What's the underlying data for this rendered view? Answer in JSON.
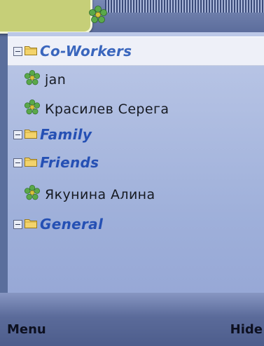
{
  "contact_list": {
    "items": [
      {
        "type": "group",
        "label": "Co-Workers",
        "selected": true
      },
      {
        "type": "contact",
        "label": "jan"
      },
      {
        "type": "contact",
        "label": "Красилев Серега"
      },
      {
        "type": "group",
        "label": "Family"
      },
      {
        "type": "group",
        "label": "Friends"
      },
      {
        "type": "contact",
        "label": "Якунина Алина"
      },
      {
        "type": "group",
        "label": "General"
      }
    ]
  },
  "softkeys": {
    "left": "Menu",
    "right": "Hide"
  },
  "icons": {
    "title": "icq-flower-icon",
    "group": "folder-icon",
    "contact": "icq-flower-icon"
  },
  "colors": {
    "group_text": "#2550b4",
    "contact_text": "#161a22",
    "panel_background": "#bcc8e7",
    "softbar_background": "#5b6b9a"
  }
}
